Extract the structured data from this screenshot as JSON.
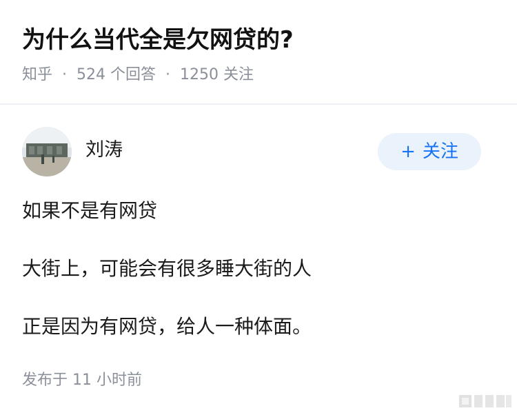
{
  "question": {
    "title": "为什么当代全是欠网贷的?",
    "source": "知乎",
    "separator": "·",
    "answer_count": "524",
    "answer_label": "个回答",
    "follow_count": "1250",
    "follow_label": "关注"
  },
  "answer": {
    "author": {
      "name": "刘涛",
      "avatar_icon": "avatar-photo"
    },
    "follow_button": {
      "plus": "+",
      "label": "关注"
    },
    "paragraphs": [
      "如果不是有网贷",
      "大街上，可能会有很多睡大街的人",
      "正是因为有网贷，给人一种体面。"
    ],
    "published_label": "发布于",
    "published_time": "11 小时前"
  },
  "colors": {
    "accent": "#1772f6",
    "follow_bg": "#eaf2fb",
    "meta_text": "#8a8f99",
    "divider": "#eef0f3"
  }
}
